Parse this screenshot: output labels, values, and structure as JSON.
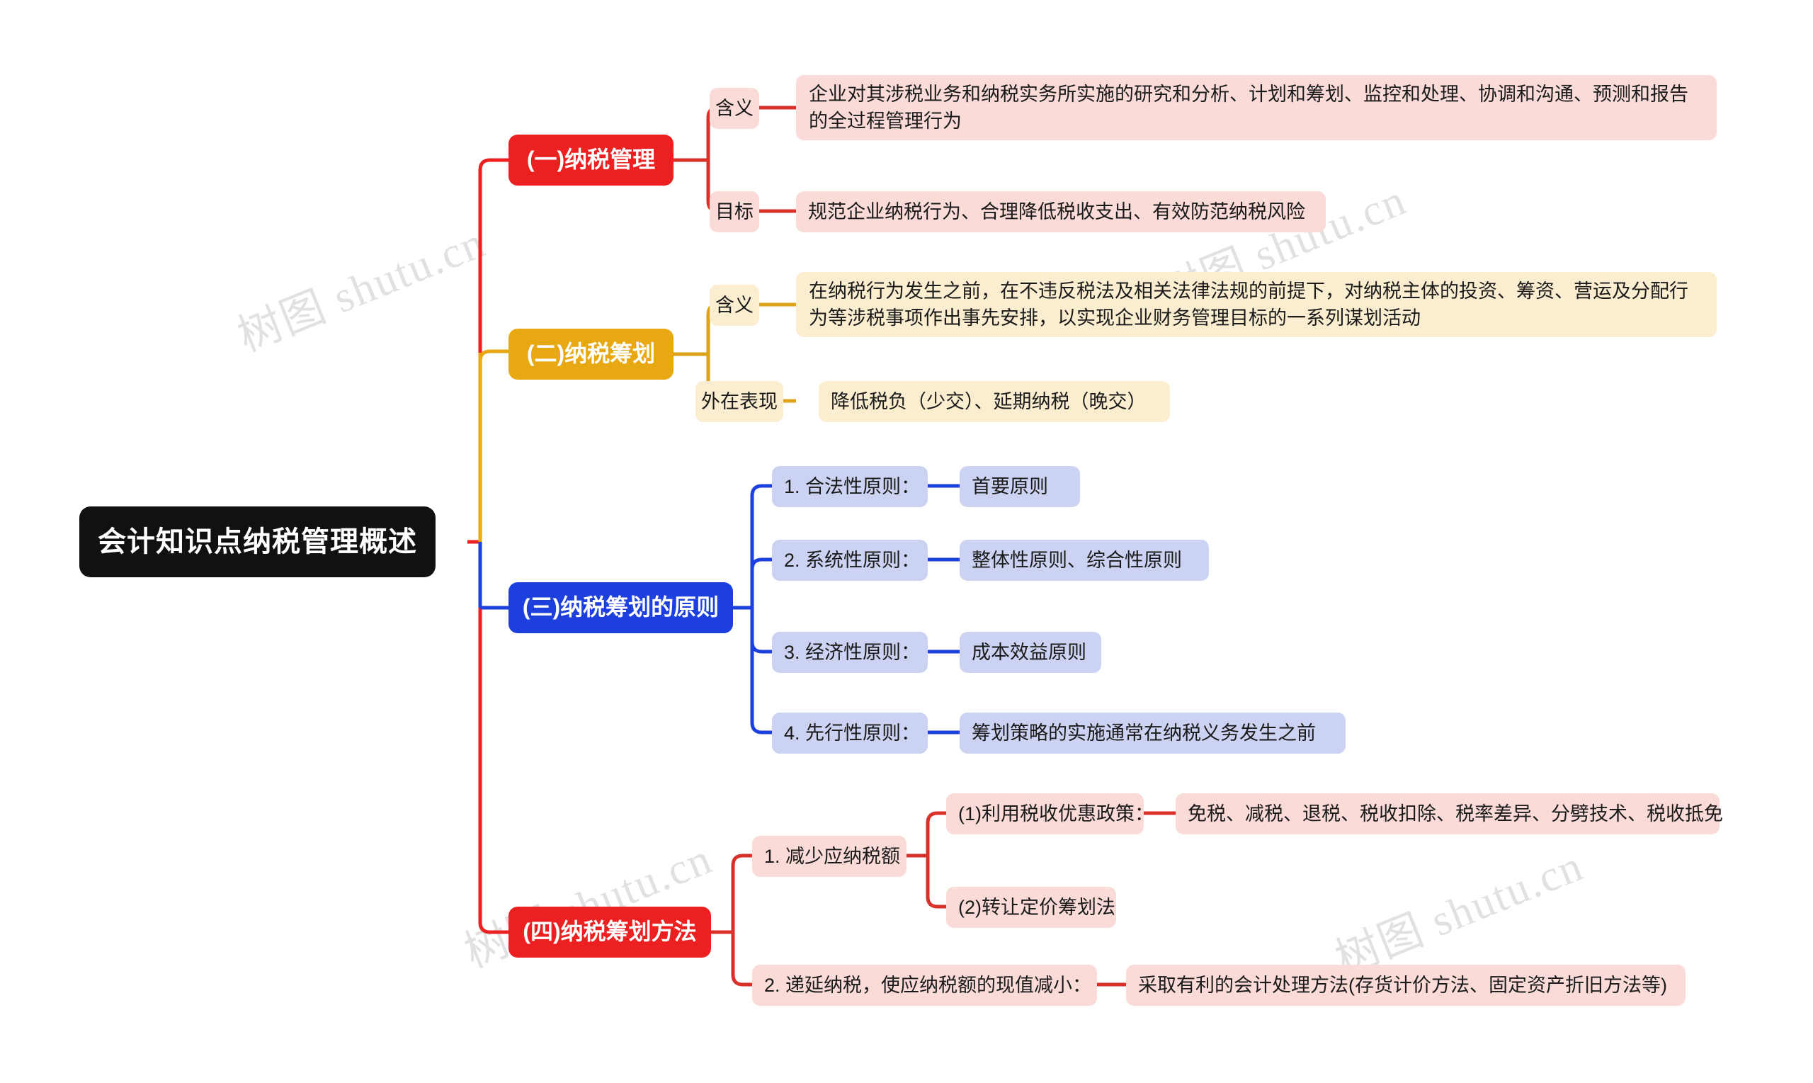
{
  "title": "会计知识点纳税管理概述",
  "watermark": "树图 shutu.cn",
  "colors": {
    "root_bg": "#111111",
    "branch1": "#ec2020",
    "branch2": "#e8a812",
    "branch3": "#1c3fde",
    "branch4": "#ec2020",
    "leaf_pink": "#fadbd8",
    "leaf_cream": "#fbeed0",
    "leaf_lilac": "#ccd2f2"
  },
  "root": {
    "label": "会计知识点纳税管理概述"
  },
  "branches": [
    {
      "label": "(一)纳税管理",
      "color": "#ec2020",
      "children": [
        {
          "label": "含义",
          "value": "企业对其涉税业务和纳税实务所实施的研究和分析、计划和筹划、监控和处理、协调和沟通、预测和报告的全过程管理行为"
        },
        {
          "label": "目标",
          "value": "规范企业纳税行为、合理降低税收支出、有效防范纳税风险"
        }
      ]
    },
    {
      "label": "(二)纳税筹划",
      "color": "#e8a812",
      "children": [
        {
          "label": "含义",
          "value": "在纳税行为发生之前，在不违反税法及相关法律法规的前提下，对纳税主体的投资、筹资、营运及分配行为等涉税事项作出事先安排，以实现企业财务管理目标的一系列谋划活动"
        },
        {
          "label": "外在表现",
          "value": "降低税负（少交）、延期纳税（晚交）"
        }
      ]
    },
    {
      "label": "(三)纳税筹划的原则",
      "color": "#1c3fde",
      "children": [
        {
          "label": "1. 合法性原则：",
          "value": "首要原则"
        },
        {
          "label": "2. 系统性原则：",
          "value": "整体性原则、综合性原则"
        },
        {
          "label": "3. 经济性原则：",
          "value": "成本效益原则"
        },
        {
          "label": "4. 先行性原则：",
          "value": "筹划策略的实施通常在纳税义务发生之前"
        }
      ]
    },
    {
      "label": "(四)纳税筹划方法",
      "color": "#ec2020",
      "children": [
        {
          "label": "1. 减少应纳税额",
          "grandchildren": [
            {
              "label": "(1)利用税收优惠政策：",
              "value": "免税、减税、退税、税收扣除、税率差异、分劈技术、税收抵免"
            },
            {
              "label": "(2)转让定价筹划法"
            }
          ]
        },
        {
          "label": "2. 递延纳税，使应纳税额的现值减小：",
          "value": "采取有利的会计处理方法(存货计价方法、固定资产折旧方法等)"
        }
      ]
    }
  ]
}
